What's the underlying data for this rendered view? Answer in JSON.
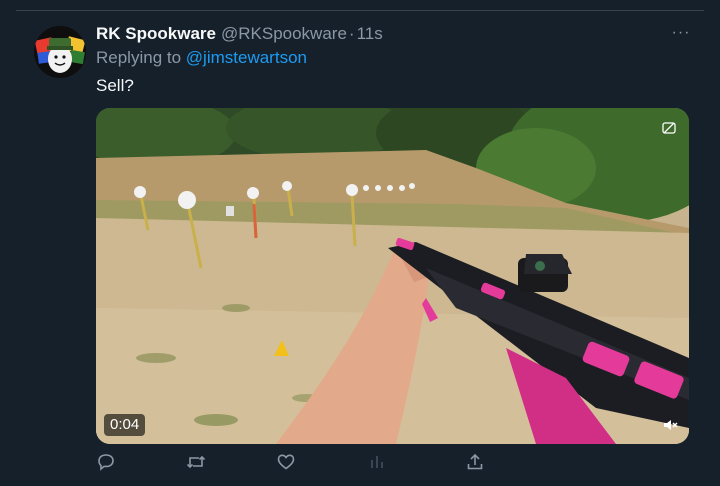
{
  "tweet": {
    "display_name": "RK Spookware",
    "handle": "@RKSpookware",
    "separator": "·",
    "time": "11s",
    "reply_prefix": "Replying to",
    "reply_to": "@jimstewartson",
    "text": "Sell?",
    "more_label": "···"
  },
  "media": {
    "duration": "0:04"
  },
  "actions": [
    "reply-icon",
    "retweet-icon",
    "like-icon",
    "analytics-icon",
    "share-icon"
  ],
  "colors": {
    "background": "#15202b",
    "link": "#1d9bf0",
    "muted_text": "#8b98a5",
    "divider": "#38444d"
  }
}
